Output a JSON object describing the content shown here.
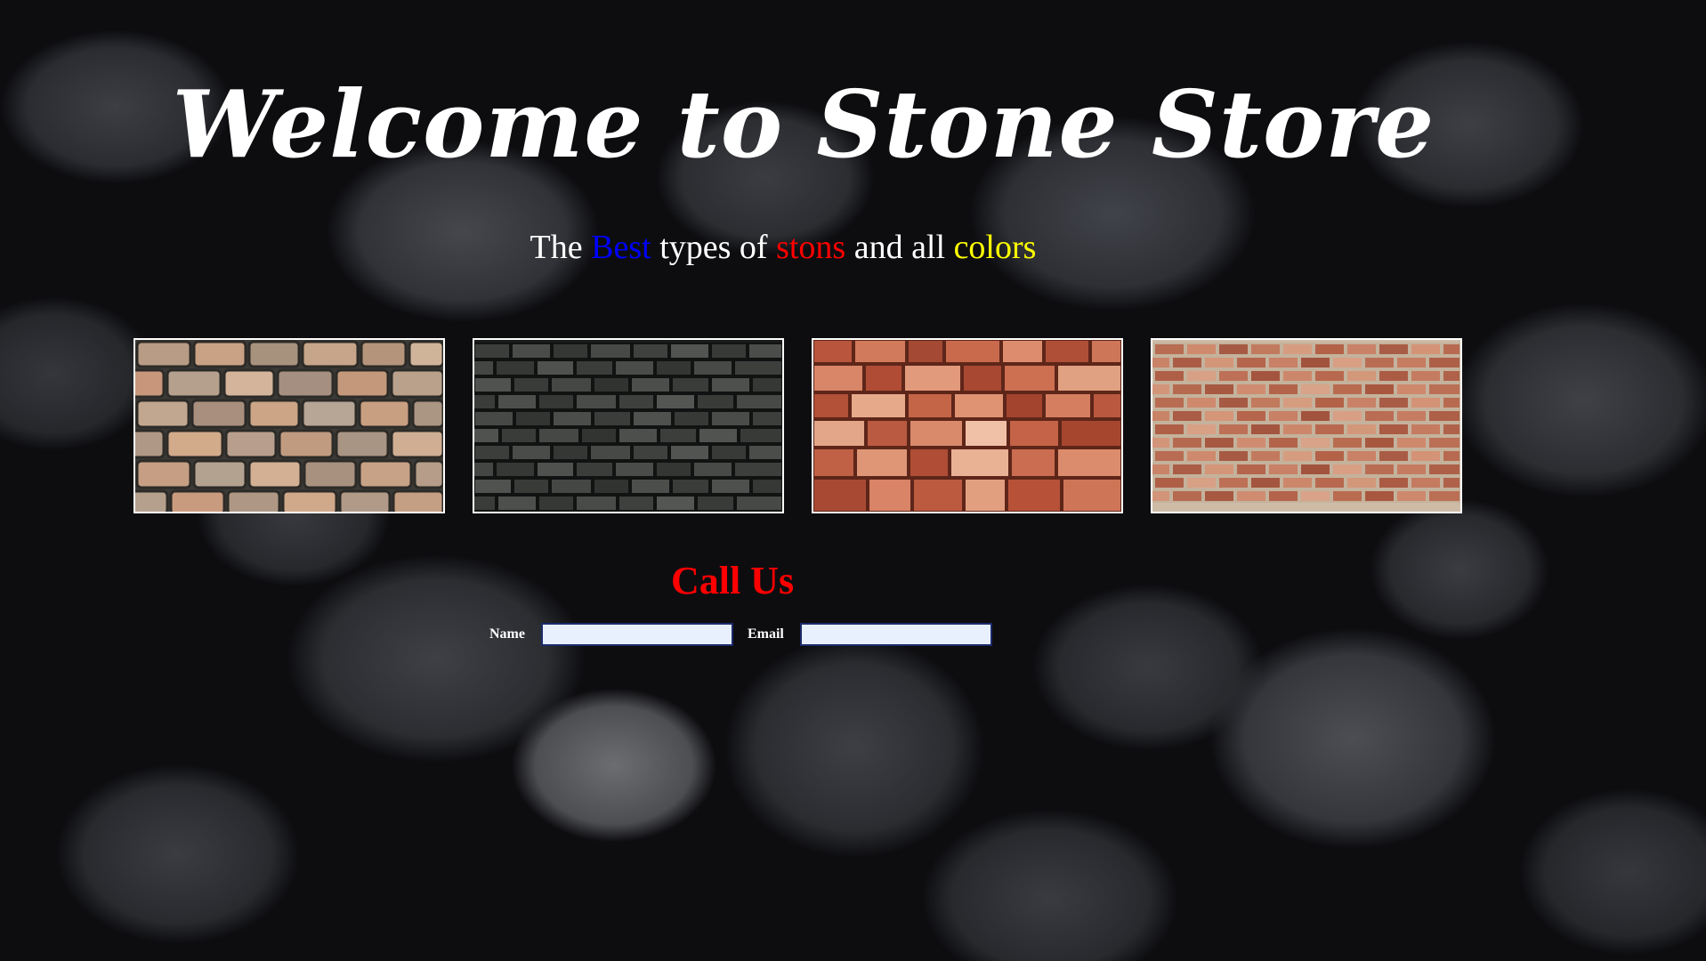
{
  "header": {
    "title": "Welcome to Stone Store"
  },
  "tagline": {
    "part1": "The ",
    "best": "Best",
    "part2": " types of ",
    "stons": "stons",
    "part3": " and all ",
    "colors": "colors",
    "colors_map": {
      "best": "#0000ff",
      "stons": "#ff0000",
      "colors": "#ffff00"
    }
  },
  "gallery": {
    "items": [
      {
        "name": "beige-brick-wall-image"
      },
      {
        "name": "dark-gray-brick-wall-image"
      },
      {
        "name": "red-stone-wall-image"
      },
      {
        "name": "red-brick-wall-image"
      }
    ]
  },
  "contact": {
    "title": "Call Us",
    "name_label": "Name",
    "name_value": "",
    "email_label": "Email",
    "email_value": ""
  },
  "theme": {
    "background": "dark pebbles",
    "accent_red": "#ff0000",
    "input_bg": "#e8f0fe",
    "input_border": "#1b2a6b"
  }
}
